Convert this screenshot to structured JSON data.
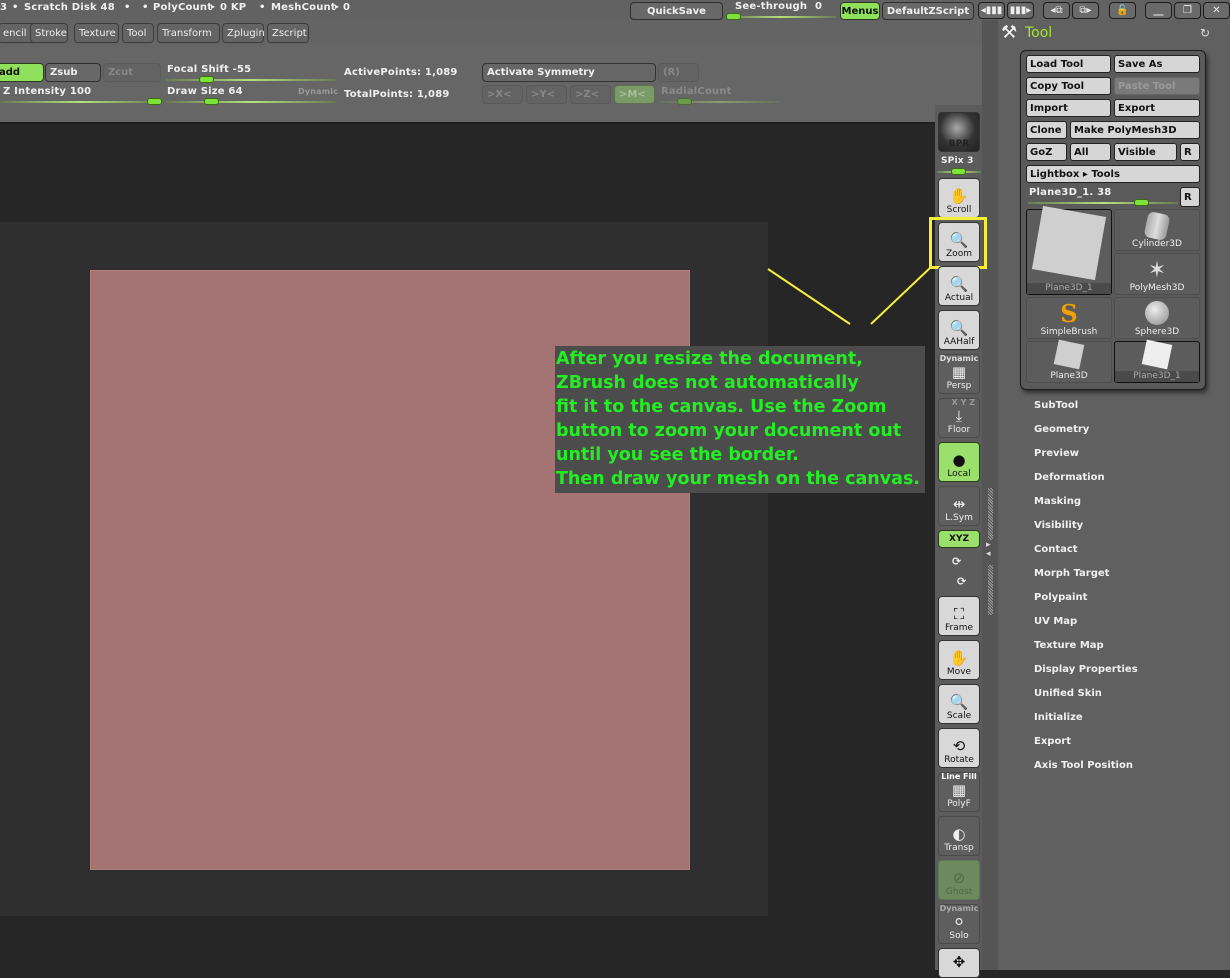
{
  "topbar": {
    "status_items": [
      "3",
      "Scratch Disk 48",
      "PolyCount",
      "0 KP",
      "MeshCount",
      "0"
    ],
    "quicksave_label": "QuickSave",
    "seethrough_label": "See-through",
    "seethrough_value": "0",
    "seethrough_fraction": 0.0,
    "menus_label": "Menus",
    "zscript_label": "DefaultZScript",
    "window_icons": [
      "shrink-left-icon",
      "shrink-right-icon",
      "layout-prev-icon",
      "layout-next-icon",
      "lock-icon",
      "minimize-icon",
      "restore-icon",
      "close-icon"
    ],
    "window_glyphs": [
      "◂▮▮▮",
      "▮▮▮▸",
      "◂⧉",
      "⧉▸",
      "🔓",
      "⎽",
      "❐",
      "✕"
    ]
  },
  "menubar": {
    "items": [
      "encil",
      "Stroke",
      "Texture",
      "Tool",
      "Transform",
      "Zplugin",
      "Zscript"
    ]
  },
  "shelf": {
    "zadd": "add",
    "zsub": "Zsub",
    "zcut": "Zcut",
    "z_intensity_label": "Z Intensity 100",
    "z_intensity_fraction": 1.0,
    "focal_shift_label": "Focal Shift -55",
    "focal_shift_fraction": 0.22,
    "draw_size_label": "Draw Size 64",
    "draw_size_fraction": 0.26,
    "dynamic_label": "Dynamic",
    "active_points": "ActivePoints: 1,089",
    "total_points": "TotalPoints: 1,089",
    "activate_symmetry": "Activate Symmetry",
    "r_label": "(R)",
    "sym_x": ">X<",
    "sym_y": ">Y<",
    "sym_z": ">Z<",
    "sym_m": ">M<",
    "radial_count": "RadialCount",
    "radial_fraction": 0.2
  },
  "rshelf": {
    "bpr": "BPR",
    "spix": "SPix 3",
    "spix_fraction": 0.5,
    "scroll": "Scroll",
    "zoom": "Zoom",
    "actual": "Actual",
    "aahalf": "AAHalf",
    "persp_tag": "Dynamic",
    "persp": "Persp",
    "floor_tag": "X Y Z",
    "floor": "Floor",
    "local": "Local",
    "lsym": "L.Sym",
    "xyz": "XYZ",
    "frame": "Frame",
    "move": "Move",
    "scale": "Scale",
    "rotate": "Rotate",
    "polyf_tag": "Line Fill",
    "polyf": "PolyF",
    "transp": "Transp",
    "ghost": "Ghost",
    "solo_tag": "Dynamic",
    "solo": "Solo"
  },
  "tool_panel": {
    "title": "Tool",
    "load_tool": "Load Tool",
    "save_as": "Save As",
    "copy_tool": "Copy Tool",
    "paste_tool": "Paste Tool",
    "import": "Import",
    "export": "Export",
    "clone": "Clone",
    "make_polymesh": "Make PolyMesh3D",
    "goz": "GoZ",
    "all": "All",
    "visible": "Visible",
    "r": "R",
    "lightbox": "Lightbox ▸ Tools",
    "current_tool": "Plane3D_1. 38",
    "current_tool_fraction": 0.75,
    "thumbnails": [
      {
        "label": "Plane3D_1",
        "selected": true
      },
      {
        "label": "Cylinder3D"
      },
      {
        "label": "PolyMesh3D"
      },
      {
        "label": "SimpleBrush"
      },
      {
        "label": "Sphere3D"
      },
      {
        "label": "Plane3D"
      },
      {
        "label": "Plane3D_1",
        "selected": true
      }
    ],
    "subpalettes": [
      "SubTool",
      "Geometry",
      "Preview",
      "Deformation",
      "Masking",
      "Visibility",
      "Contact",
      "Morph Target",
      "Polypaint",
      "UV Map",
      "Texture Map",
      "Display Properties",
      "Unified Skin",
      "Initialize",
      "Export",
      "Axis Tool Position"
    ]
  },
  "annotation": {
    "text": "After you resize the document,\nZBrush does not automatically\nfit it to the canvas. Use the Zoom\nbutton to zoom your document out\nuntil you see the border.\nThen draw your mesh on the canvas.",
    "text_color": "#22ee22",
    "highlight_color": "#f5ef3a"
  },
  "colors": {
    "accent_green": "#8fe05a",
    "document": "#a47474",
    "tool_title": "#a6e22e"
  }
}
